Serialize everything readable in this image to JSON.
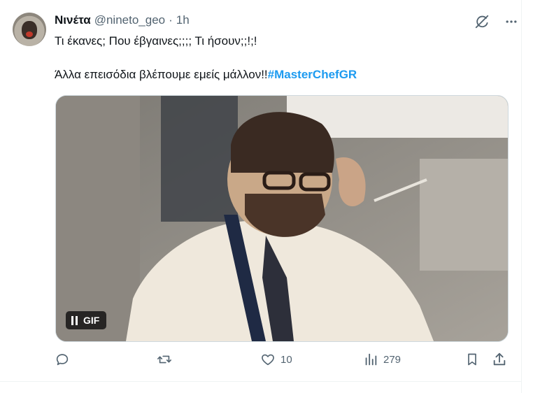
{
  "tweet": {
    "author_name": "Νινέτα",
    "handle": "@nineto_geo",
    "separator": "·",
    "time": "1h",
    "text_line1": "Τι έκανες; Που έβγαινες;;;; Τι ήσουν;;!;!",
    "text_line2": "Άλλα  επεισόδια βλέπουμε εμείς μάλλον!!",
    "hashtag": "#MasterChefGR"
  },
  "media": {
    "badge_label": "GIF"
  },
  "actions": {
    "reply_count": "",
    "retweet_count": "",
    "like_count": "10",
    "views_count": "279"
  },
  "colors": {
    "accent": "#1d9bf0",
    "muted": "#536471",
    "text": "#0f1419"
  },
  "icons": [
    "grok-icon",
    "more-icon",
    "pause-icon",
    "reply-icon",
    "retweet-icon",
    "like-icon",
    "views-icon",
    "bookmark-icon",
    "share-icon"
  ]
}
